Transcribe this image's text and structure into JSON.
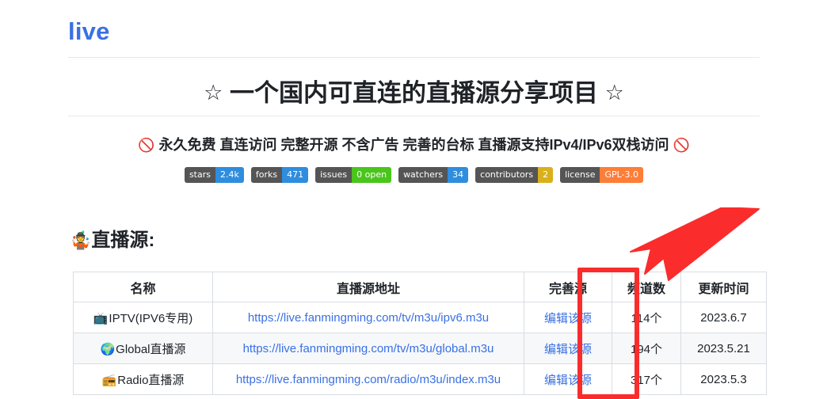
{
  "repo": {
    "title": "live"
  },
  "heading": {
    "star_left": "☆",
    "text": "一个国内可直连的直播源分享项目",
    "star_right": "☆"
  },
  "subtitle": {
    "icon_left": "🚫",
    "text": "永久免费 直连访问 完整开源 不含广告 完善的台标 直播源支持IPv4/IPv6双栈访问",
    "icon_right": "🚫"
  },
  "badges": [
    {
      "label": "stars",
      "value": "2.4k",
      "color": "#2f8ddd"
    },
    {
      "label": "forks",
      "value": "471",
      "color": "#2f8ddd"
    },
    {
      "label": "issues",
      "value": "0 open",
      "color": "#4ac51c"
    },
    {
      "label": "watchers",
      "value": "34",
      "color": "#2f8ddd"
    },
    {
      "label": "contributors",
      "value": "2",
      "color": "#d9b01c"
    },
    {
      "label": "license",
      "value": "GPL-3.0",
      "color": "#fe7d37"
    }
  ],
  "section": {
    "emoji": "🤹",
    "title": "直播源:"
  },
  "table": {
    "headers": {
      "name": "名称",
      "url": "直播源地址",
      "edit": "完善源",
      "count": "频道数",
      "updated": "更新时间"
    },
    "rows": [
      {
        "emoji": "📺",
        "name": "IPTV(IPV6专用)",
        "url": "https://live.fanmingming.com/tv/m3u/ipv6.m3u",
        "edit": "编辑该源",
        "count": "114个",
        "updated": "2023.6.7"
      },
      {
        "emoji": "🌍",
        "name": "Global直播源",
        "url": "https://live.fanmingming.com/tv/m3u/global.m3u",
        "edit": "编辑该源",
        "count": "194个",
        "updated": "2023.5.21"
      },
      {
        "emoji": "📻",
        "name": "Radio直播源",
        "url": "https://live.fanmingming.com/radio/m3u/index.m3u",
        "edit": "编辑该源",
        "count": "317个",
        "updated": "2023.5.3"
      }
    ]
  },
  "annotation": {
    "highlight_color": "#fb2c2c"
  }
}
